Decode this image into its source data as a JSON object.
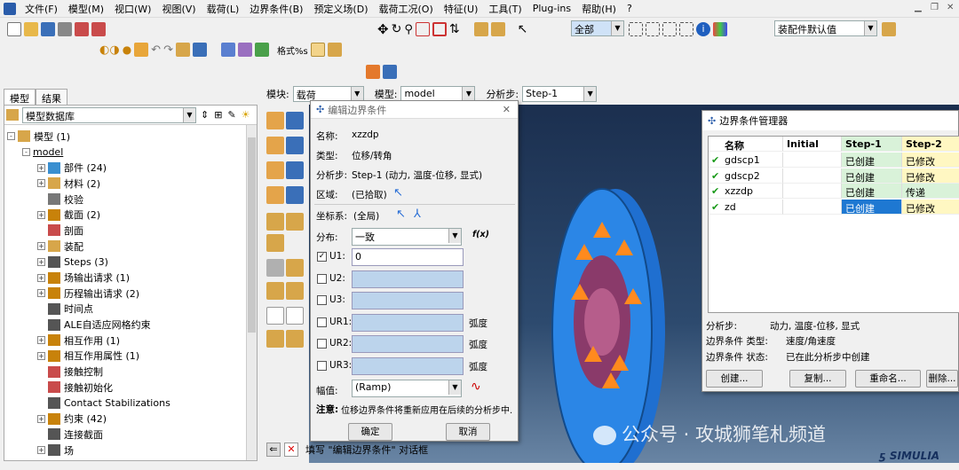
{
  "menubar": {
    "items": [
      "文件(F)",
      "模型(M)",
      "视口(W)",
      "视图(V)",
      "载荷(L)",
      "边界条件(B)",
      "预定义场(D)",
      "载荷工况(O)",
      "特征(U)",
      "工具(T)",
      "Plug-ins",
      "帮助(H)"
    ],
    "help_icon": "?"
  },
  "toolbar": {
    "select_filter": "全部",
    "render_style": "装配件默认值",
    "format_label": "格式",
    "format_suffix": "%s"
  },
  "tabs": {
    "model": "模型",
    "results": "结果"
  },
  "tree": {
    "header": "模型数据库",
    "rows": [
      {
        "label": "模型 (1)",
        "exp": "-"
      },
      {
        "label": "model",
        "exp": "-"
      },
      {
        "label": "部件 (24)",
        "exp": "+"
      },
      {
        "label": "材料 (2)",
        "exp": "+"
      },
      {
        "label": "校验",
        "exp": ""
      },
      {
        "label": "截面 (2)",
        "exp": "+"
      },
      {
        "label": "剖面",
        "exp": ""
      },
      {
        "label": "装配",
        "exp": "+"
      },
      {
        "label": "Steps (3)",
        "exp": "+"
      },
      {
        "label": "场输出请求 (1)",
        "exp": "+"
      },
      {
        "label": "历程输出请求 (2)",
        "exp": "+"
      },
      {
        "label": "时间点",
        "exp": ""
      },
      {
        "label": "ALE自适应网格约束",
        "exp": ""
      },
      {
        "label": "相互作用 (1)",
        "exp": "+"
      },
      {
        "label": "相互作用属性 (1)",
        "exp": "+"
      },
      {
        "label": "接触控制",
        "exp": ""
      },
      {
        "label": "接触初始化",
        "exp": ""
      },
      {
        "label": "Contact Stabilizations",
        "exp": ""
      },
      {
        "label": "约束 (42)",
        "exp": "+"
      },
      {
        "label": "连接截面",
        "exp": ""
      },
      {
        "label": "场",
        "exp": "+"
      }
    ]
  },
  "context": {
    "module_label": "模块:",
    "module_value": "载荷",
    "model_label": "模型:",
    "model_value": "model",
    "step_label": "分析步:",
    "step_value": "Step-1"
  },
  "dialog": {
    "title": "编辑边界条件",
    "name_label": "名称:",
    "name_value": "xzzdp",
    "type_label": "类型:",
    "type_value": "位移/转角",
    "step_label": "分析步:",
    "step_value": "Step-1 (动力, 温度-位移, 显式)",
    "region_label": "区域:",
    "region_value": "(已拾取)",
    "csys_label": "坐标系:",
    "csys_value": "(全局)",
    "dist_label": "分布:",
    "dist_value": "一致",
    "fx": "f(x)",
    "dofs": [
      {
        "label": "U1:",
        "value": "0",
        "checked": true,
        "unit": ""
      },
      {
        "label": "U2:",
        "value": "",
        "checked": false,
        "unit": ""
      },
      {
        "label": "U3:",
        "value": "",
        "checked": false,
        "unit": ""
      },
      {
        "label": "UR1:",
        "value": "",
        "checked": false,
        "unit": "弧度"
      },
      {
        "label": "UR2:",
        "value": "",
        "checked": false,
        "unit": "弧度"
      },
      {
        "label": "UR3:",
        "value": "",
        "checked": false,
        "unit": "弧度"
      }
    ],
    "amp_label": "幅值:",
    "amp_value": "(Ramp)",
    "note_label": "注意:",
    "note_text": "位移边界条件将重新应用在后续的分析步中.",
    "ok": "确定",
    "cancel": "取消"
  },
  "manager": {
    "title": "边界条件管理器",
    "columns": [
      "名称",
      "Initial",
      "Step-1",
      "Step-2"
    ],
    "rows": [
      {
        "name": "gdscp1",
        "initial": "",
        "step1": "已创建",
        "step2": "已修改"
      },
      {
        "name": "gdscp2",
        "initial": "",
        "step1": "已创建",
        "step2": "已修改"
      },
      {
        "name": "xzzdp",
        "initial": "",
        "step1": "已创建",
        "step2": "传递"
      },
      {
        "name": "zd",
        "initial": "",
        "step1": "已创建",
        "step2": "已修改"
      }
    ],
    "info_step_label": "分析步:",
    "info_step_value": "动力, 温度-位移, 显式",
    "info_type_label": "边界条件 类型:",
    "info_type_value": "速度/角速度",
    "info_status_label": "边界条件 状态:",
    "info_status_value": "已在此分析步中创建",
    "buttons": [
      "创建...",
      "复制...",
      "重命名...",
      "删除..."
    ]
  },
  "prompt": "填写 \"编辑边界条件\" 对话框",
  "watermark": "公众号 · 攻城狮笔札频道",
  "brand": "SIMULIA",
  "colors": {
    "accent_blue": "#3a9be0",
    "created_bg": "#d9f2d9",
    "modified_bg": "#fff7c2",
    "selected_bg": "#1e78d2"
  }
}
